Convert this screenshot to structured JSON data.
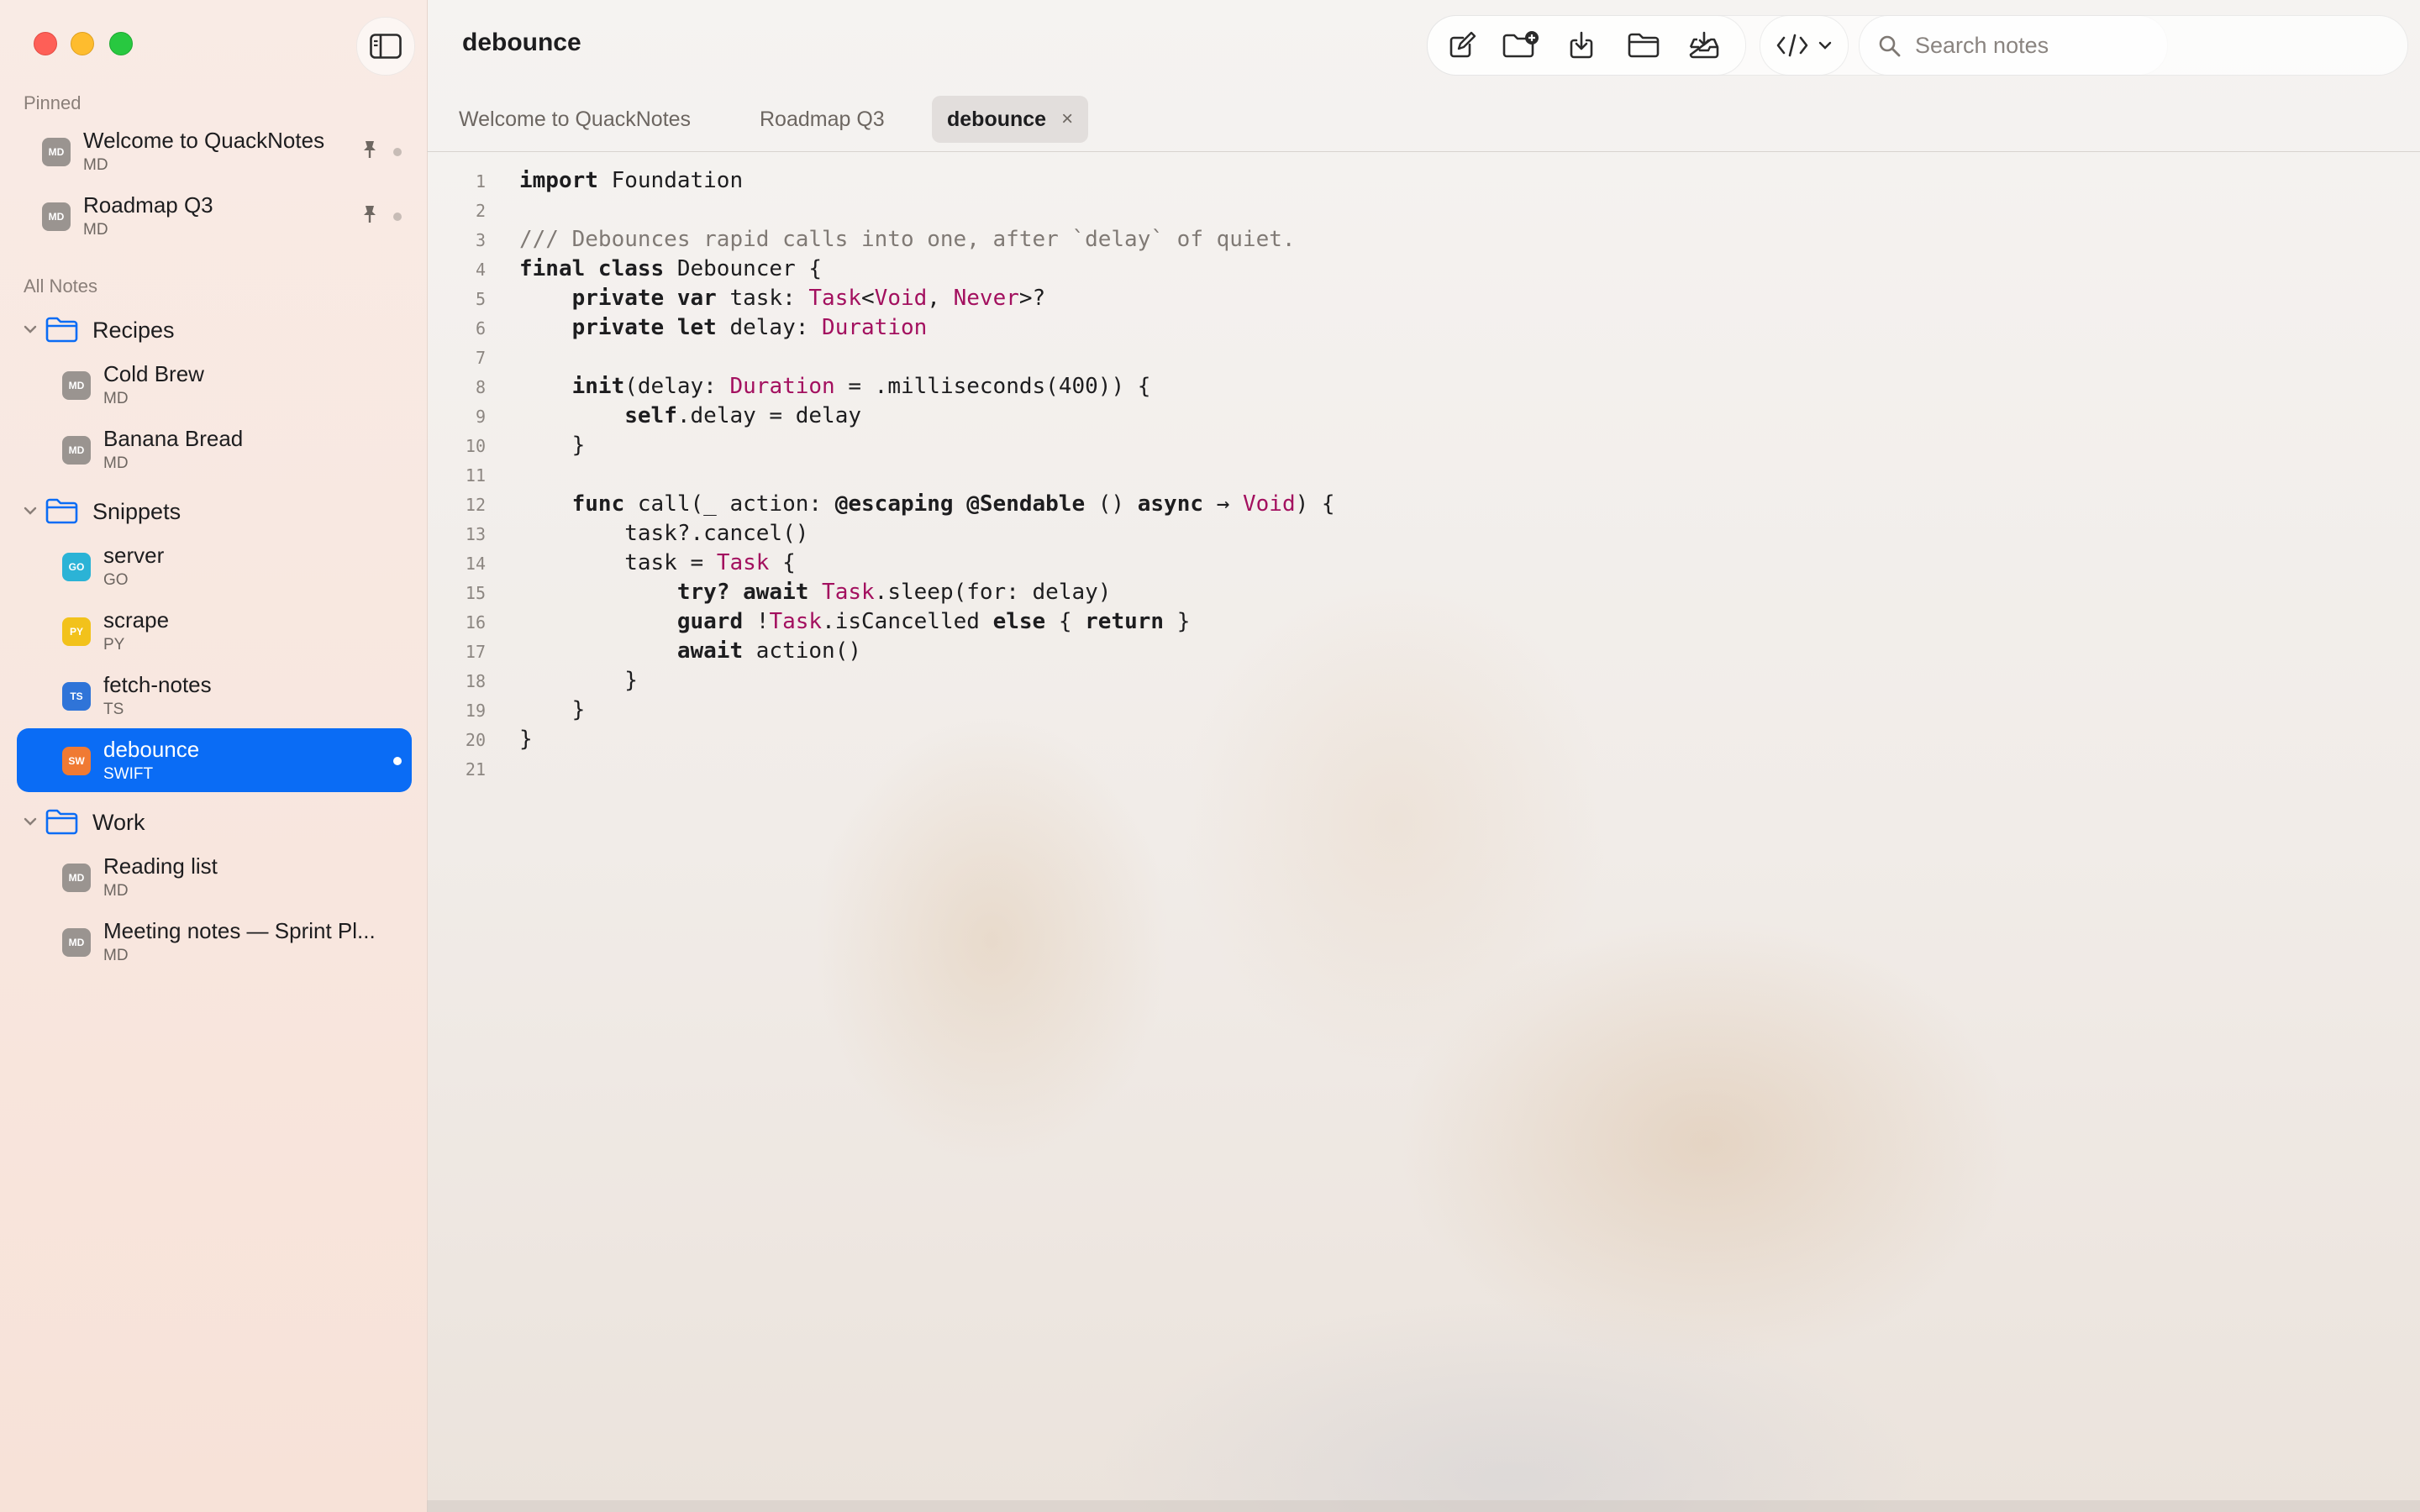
{
  "window": {
    "title": "debounce"
  },
  "sidebar": {
    "pinned_label": "Pinned",
    "all_notes_label": "All Notes",
    "pinned": [
      {
        "title": "Welcome to QuackNotes",
        "kind": "MD",
        "badge": "MD",
        "badge_color": "#9a9490"
      },
      {
        "title": "Roadmap Q3",
        "kind": "MD",
        "badge": "MD",
        "badge_color": "#9a9490"
      }
    ],
    "folders": [
      {
        "name": "Recipes",
        "notes": [
          {
            "title": "Cold Brew",
            "kind": "MD",
            "badge": "MD",
            "badge_color": "#9a9490"
          },
          {
            "title": "Banana Bread",
            "kind": "MD",
            "badge": "MD",
            "badge_color": "#9a9490"
          }
        ]
      },
      {
        "name": "Snippets",
        "notes": [
          {
            "title": "server",
            "kind": "GO",
            "badge": "GO",
            "badge_color": "#2bb3d6"
          },
          {
            "title": "scrape",
            "kind": "PY",
            "badge": "PY",
            "badge_color": "#f2c21b"
          },
          {
            "title": "fetch-notes",
            "kind": "TS",
            "badge": "TS",
            "badge_color": "#2f74d8"
          },
          {
            "title": "debounce",
            "kind": "SWIFT",
            "badge": "SW",
            "badge_color": "#f07a33",
            "selected": true
          }
        ]
      },
      {
        "name": "Work",
        "notes": [
          {
            "title": "Reading list",
            "kind": "MD",
            "badge": "MD",
            "badge_color": "#9a9490"
          },
          {
            "title": "Meeting notes — Sprint Pl...",
            "kind": "MD",
            "badge": "MD",
            "badge_color": "#9a9490"
          }
        ]
      }
    ]
  },
  "toolbar": {
    "icons": [
      "new-note-icon",
      "new-folder-icon",
      "import-icon",
      "open-folder-icon",
      "export-icon"
    ],
    "code_menu_icon": "code-icon"
  },
  "search": {
    "placeholder": "Search notes",
    "value": ""
  },
  "tabs": [
    {
      "label": "Welcome to QuackNotes"
    },
    {
      "label": "Roadmap Q3"
    },
    {
      "label": "debounce",
      "active": true,
      "close": "×"
    }
  ],
  "editor": {
    "lines": [
      [
        {
          "t": "import",
          "c": "kw"
        },
        {
          "t": " Foundation"
        }
      ],
      [],
      [
        {
          "t": "/// Debounces rapid calls into one, after `delay` of quiet.",
          "c": "cm"
        }
      ],
      [
        {
          "t": "final class",
          "c": "kw"
        },
        {
          "t": " Debouncer {"
        }
      ],
      [
        {
          "t": "    "
        },
        {
          "t": "private var",
          "c": "kw"
        },
        {
          "t": " task: "
        },
        {
          "t": "Task",
          "c": "ty"
        },
        {
          "t": "<"
        },
        {
          "t": "Void",
          "c": "ty"
        },
        {
          "t": ", "
        },
        {
          "t": "Never",
          "c": "ty"
        },
        {
          "t": ">?"
        }
      ],
      [
        {
          "t": "    "
        },
        {
          "t": "private let",
          "c": "kw"
        },
        {
          "t": " delay: "
        },
        {
          "t": "Duration",
          "c": "ty"
        }
      ],
      [],
      [
        {
          "t": "    "
        },
        {
          "t": "init",
          "c": "kw"
        },
        {
          "t": "(delay: "
        },
        {
          "t": "Duration",
          "c": "ty"
        },
        {
          "t": " = .milliseconds(400)) {"
        }
      ],
      [
        {
          "t": "        "
        },
        {
          "t": "self",
          "c": "kw"
        },
        {
          "t": ".delay = delay"
        }
      ],
      [
        {
          "t": "    }"
        }
      ],
      [],
      [
        {
          "t": "    "
        },
        {
          "t": "func",
          "c": "kw"
        },
        {
          "t": " call(_ action: "
        },
        {
          "t": "@escaping @Sendable",
          "c": "kw"
        },
        {
          "t": " () "
        },
        {
          "t": "async",
          "c": "kw"
        },
        {
          "t": " → "
        },
        {
          "t": "Void",
          "c": "ty"
        },
        {
          "t": ") {"
        }
      ],
      [
        {
          "t": "        task?.cancel()"
        }
      ],
      [
        {
          "t": "        task = "
        },
        {
          "t": "Task",
          "c": "ty"
        },
        {
          "t": " {"
        }
      ],
      [
        {
          "t": "            "
        },
        {
          "t": "try? await",
          "c": "kw"
        },
        {
          "t": " "
        },
        {
          "t": "Task",
          "c": "ty"
        },
        {
          "t": ".sleep(for: delay)"
        }
      ],
      [
        {
          "t": "            "
        },
        {
          "t": "guard",
          "c": "kw"
        },
        {
          "t": " !"
        },
        {
          "t": "Task",
          "c": "ty"
        },
        {
          "t": ".isCancelled "
        },
        {
          "t": "else",
          "c": "kw"
        },
        {
          "t": " { "
        },
        {
          "t": "return",
          "c": "kw"
        },
        {
          "t": " }"
        }
      ],
      [
        {
          "t": "            "
        },
        {
          "t": "await",
          "c": "kw"
        },
        {
          "t": " action()"
        }
      ],
      [
        {
          "t": "        }"
        }
      ],
      [
        {
          "t": "    }"
        }
      ],
      [
        {
          "t": "}"
        }
      ],
      []
    ]
  }
}
